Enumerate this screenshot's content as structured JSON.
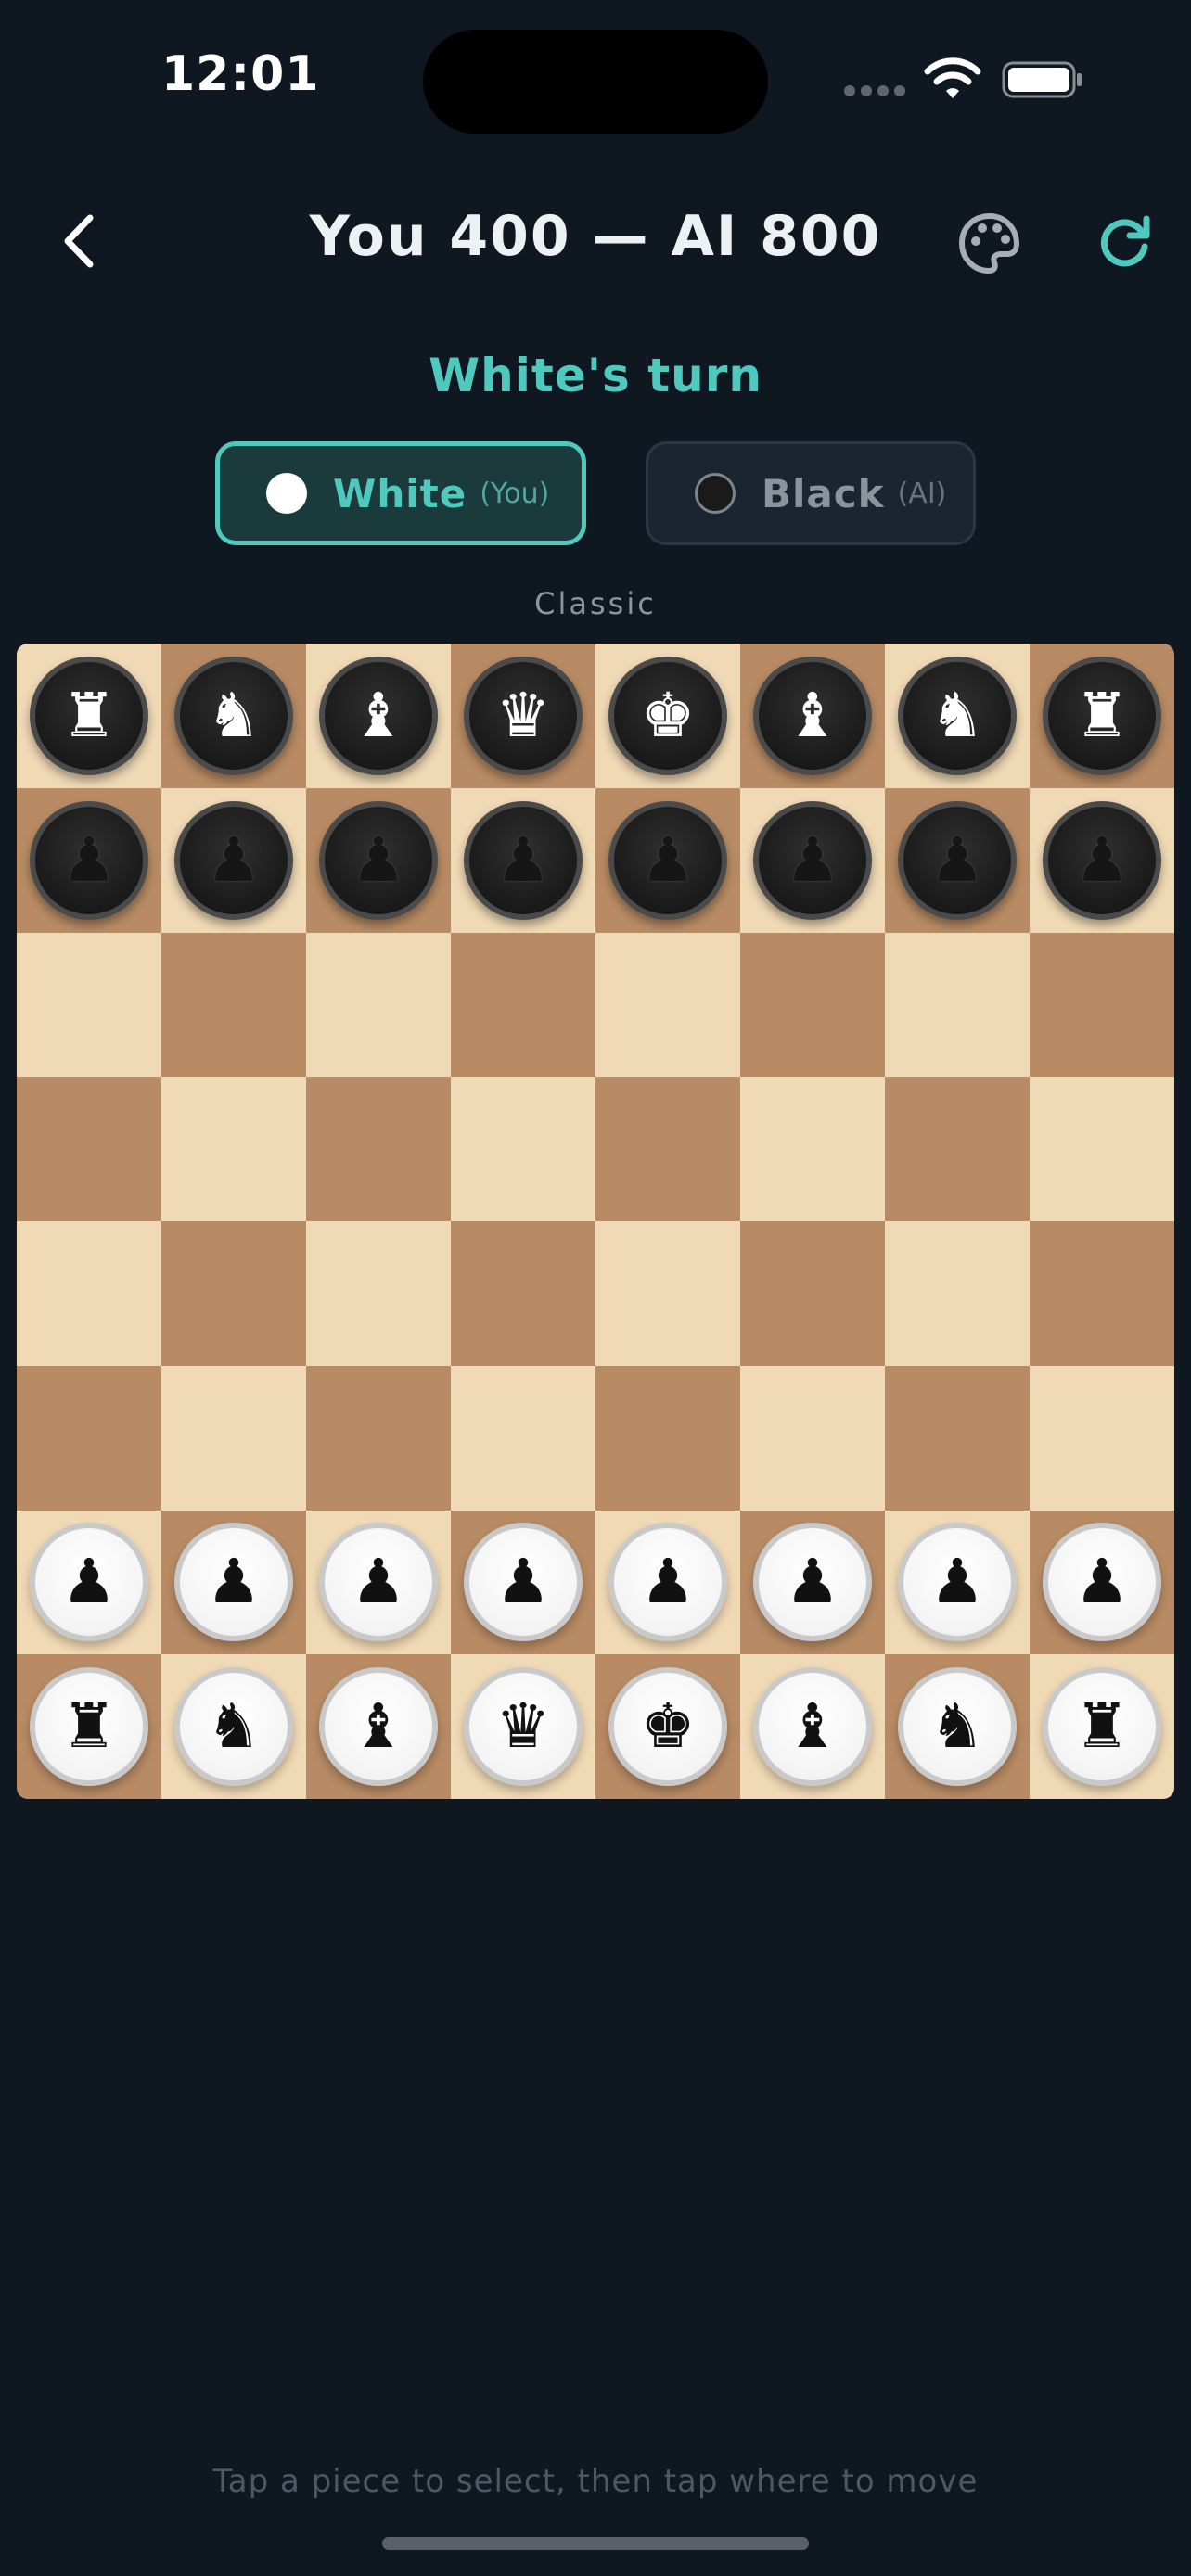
{
  "status_bar": {
    "time": "12:01"
  },
  "header": {
    "title": "You 400 — AI 800",
    "back_icon": "chevron-left-icon",
    "palette_icon": "palette-icon",
    "refresh_icon": "refresh-icon",
    "accent_color": "#4fc9be"
  },
  "turn_label": "White's turn",
  "players": [
    {
      "name": "White",
      "role": "(You)",
      "active": true
    },
    {
      "name": "Black",
      "role": "(AI)",
      "active": false
    }
  ],
  "board_theme": "Classic",
  "board": {
    "light_color": "#f0d9b5",
    "dark_color": "#b88b64",
    "rows": [
      [
        {
          "color": "black",
          "piece": "rook",
          "glyph": "♜"
        },
        {
          "color": "black",
          "piece": "knight",
          "glyph": "♞"
        },
        {
          "color": "black",
          "piece": "bishop",
          "glyph": "♝"
        },
        {
          "color": "black",
          "piece": "queen",
          "glyph": "♛"
        },
        {
          "color": "black",
          "piece": "king",
          "glyph": "♚"
        },
        {
          "color": "black",
          "piece": "bishop",
          "glyph": "♝"
        },
        {
          "color": "black",
          "piece": "knight",
          "glyph": "♞"
        },
        {
          "color": "black",
          "piece": "rook",
          "glyph": "♜"
        }
      ],
      [
        {
          "color": "black",
          "piece": "pawn",
          "glyph": "♟"
        },
        {
          "color": "black",
          "piece": "pawn",
          "glyph": "♟"
        },
        {
          "color": "black",
          "piece": "pawn",
          "glyph": "♟"
        },
        {
          "color": "black",
          "piece": "pawn",
          "glyph": "♟"
        },
        {
          "color": "black",
          "piece": "pawn",
          "glyph": "♟"
        },
        {
          "color": "black",
          "piece": "pawn",
          "glyph": "♟"
        },
        {
          "color": "black",
          "piece": "pawn",
          "glyph": "♟"
        },
        {
          "color": "black",
          "piece": "pawn",
          "glyph": "♟"
        }
      ],
      [
        null,
        null,
        null,
        null,
        null,
        null,
        null,
        null
      ],
      [
        null,
        null,
        null,
        null,
        null,
        null,
        null,
        null
      ],
      [
        null,
        null,
        null,
        null,
        null,
        null,
        null,
        null
      ],
      [
        null,
        null,
        null,
        null,
        null,
        null,
        null,
        null
      ],
      [
        {
          "color": "white",
          "piece": "pawn",
          "glyph": "♟"
        },
        {
          "color": "white",
          "piece": "pawn",
          "glyph": "♟"
        },
        {
          "color": "white",
          "piece": "pawn",
          "glyph": "♟"
        },
        {
          "color": "white",
          "piece": "pawn",
          "glyph": "♟"
        },
        {
          "color": "white",
          "piece": "pawn",
          "glyph": "♟"
        },
        {
          "color": "white",
          "piece": "pawn",
          "glyph": "♟"
        },
        {
          "color": "white",
          "piece": "pawn",
          "glyph": "♟"
        },
        {
          "color": "white",
          "piece": "pawn",
          "glyph": "♟"
        }
      ],
      [
        {
          "color": "white",
          "piece": "rook",
          "glyph": "♜"
        },
        {
          "color": "white",
          "piece": "knight",
          "glyph": "♞"
        },
        {
          "color": "white",
          "piece": "bishop",
          "glyph": "♝"
        },
        {
          "color": "white",
          "piece": "queen",
          "glyph": "♛"
        },
        {
          "color": "white",
          "piece": "king",
          "glyph": "♚"
        },
        {
          "color": "white",
          "piece": "bishop",
          "glyph": "♝"
        },
        {
          "color": "white",
          "piece": "knight",
          "glyph": "♞"
        },
        {
          "color": "white",
          "piece": "rook",
          "glyph": "♜"
        }
      ]
    ]
  },
  "hint": "Tap a piece to select, then tap where to move"
}
